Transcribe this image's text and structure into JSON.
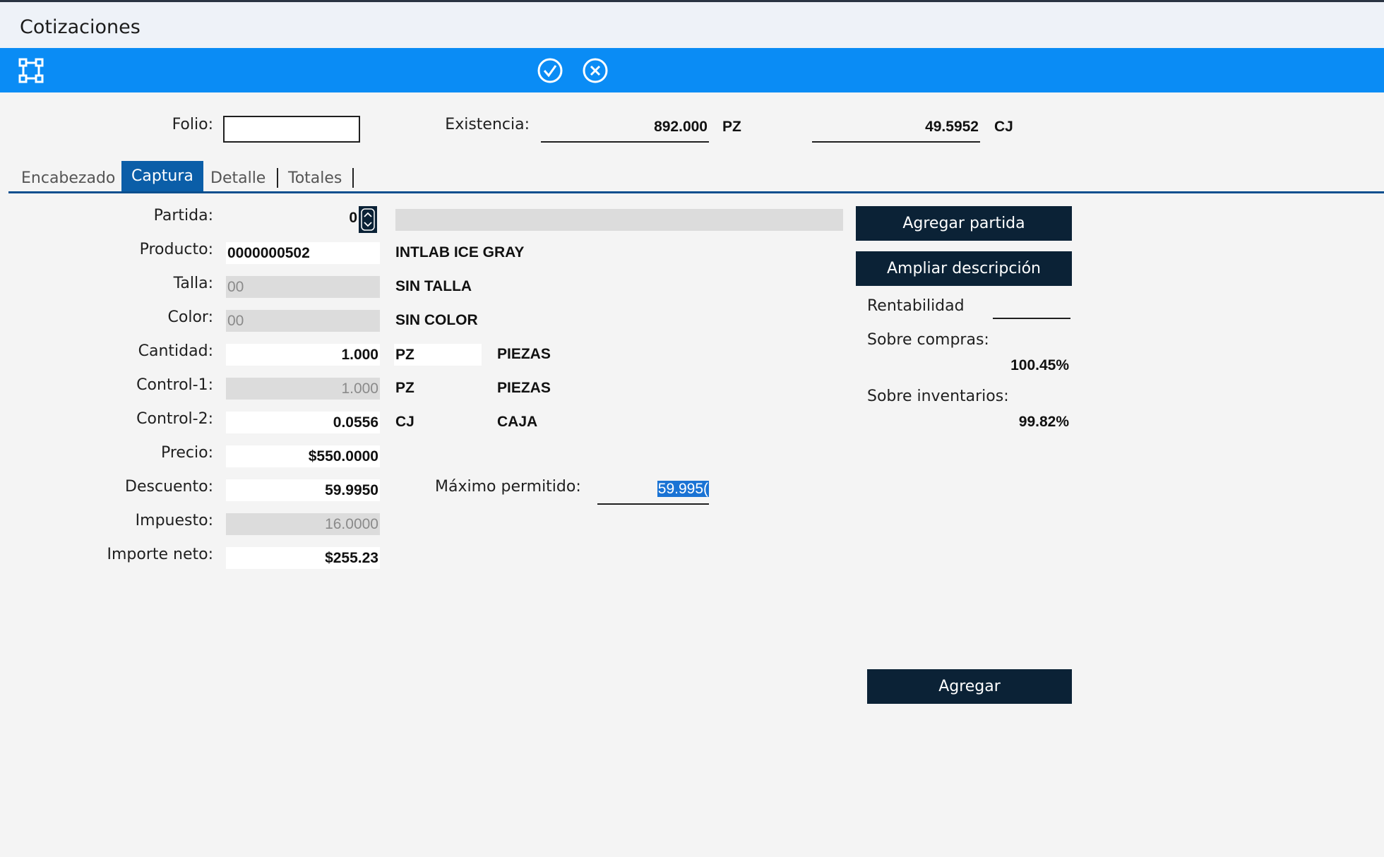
{
  "window": {
    "title": "Cotizaciones"
  },
  "toolbar": {
    "icons": [
      "frame-select-icon",
      "confirm-check-icon",
      "cancel-x-icon"
    ]
  },
  "header": {
    "folio_label": "Folio:",
    "folio_value": "",
    "existencia_label": "Existencia:",
    "existencia_qty1": "892.000",
    "existencia_unit1": "PZ",
    "existencia_qty2": "49.5952",
    "existencia_unit2": "CJ"
  },
  "tabs": [
    {
      "label": "Encabezado",
      "active": false
    },
    {
      "label": "Captura",
      "active": true
    },
    {
      "label": "Detalle",
      "active": false
    },
    {
      "label": "Totales",
      "active": false
    }
  ],
  "form": {
    "partida": {
      "label": "Partida:",
      "value": "0"
    },
    "producto": {
      "label": "Producto:",
      "value": "0000000502",
      "desc": "INTLAB ICE GRAY"
    },
    "talla": {
      "label": "Talla:",
      "value": "00",
      "desc": "SIN TALLA"
    },
    "color": {
      "label": "Color:",
      "value": "00",
      "desc": "SIN COLOR"
    },
    "cantidad": {
      "label": "Cantidad:",
      "value": "1.000",
      "unit": "PZ",
      "unit_desc": "PIEZAS"
    },
    "control1": {
      "label": "Control-1:",
      "value": "1.000",
      "unit": "PZ",
      "unit_desc": "PIEZAS"
    },
    "control2": {
      "label": "Control-2:",
      "value": "0.0556",
      "unit": "CJ",
      "unit_desc": "CAJA"
    },
    "precio": {
      "label": "Precio:",
      "value": "$550.0000"
    },
    "descuento": {
      "label": "Descuento:",
      "value": "59.9950"
    },
    "maximo": {
      "label": "Máximo permitido:",
      "value": "59.995("
    },
    "impuesto": {
      "label": "Impuesto:",
      "value": "16.0000"
    },
    "importe": {
      "label": "Importe neto:",
      "value": "$255.23"
    }
  },
  "side": {
    "agregar_partida": "Agregar partida",
    "ampliar_descripcion": "Ampliar descripción",
    "rentabilidad_label": "Rentabilidad",
    "sobre_compras_label": "Sobre compras:",
    "sobre_compras_value": "100.45%",
    "sobre_inventarios_label": "Sobre inventarios:",
    "sobre_inventarios_value": "99.82%"
  },
  "footer": {
    "agregar": "Agregar"
  },
  "colors": {
    "toolbar": "#0a8cf5",
    "button": "#0b2236",
    "tab_active": "#0b5ea8",
    "selection": "#1a73d4"
  }
}
